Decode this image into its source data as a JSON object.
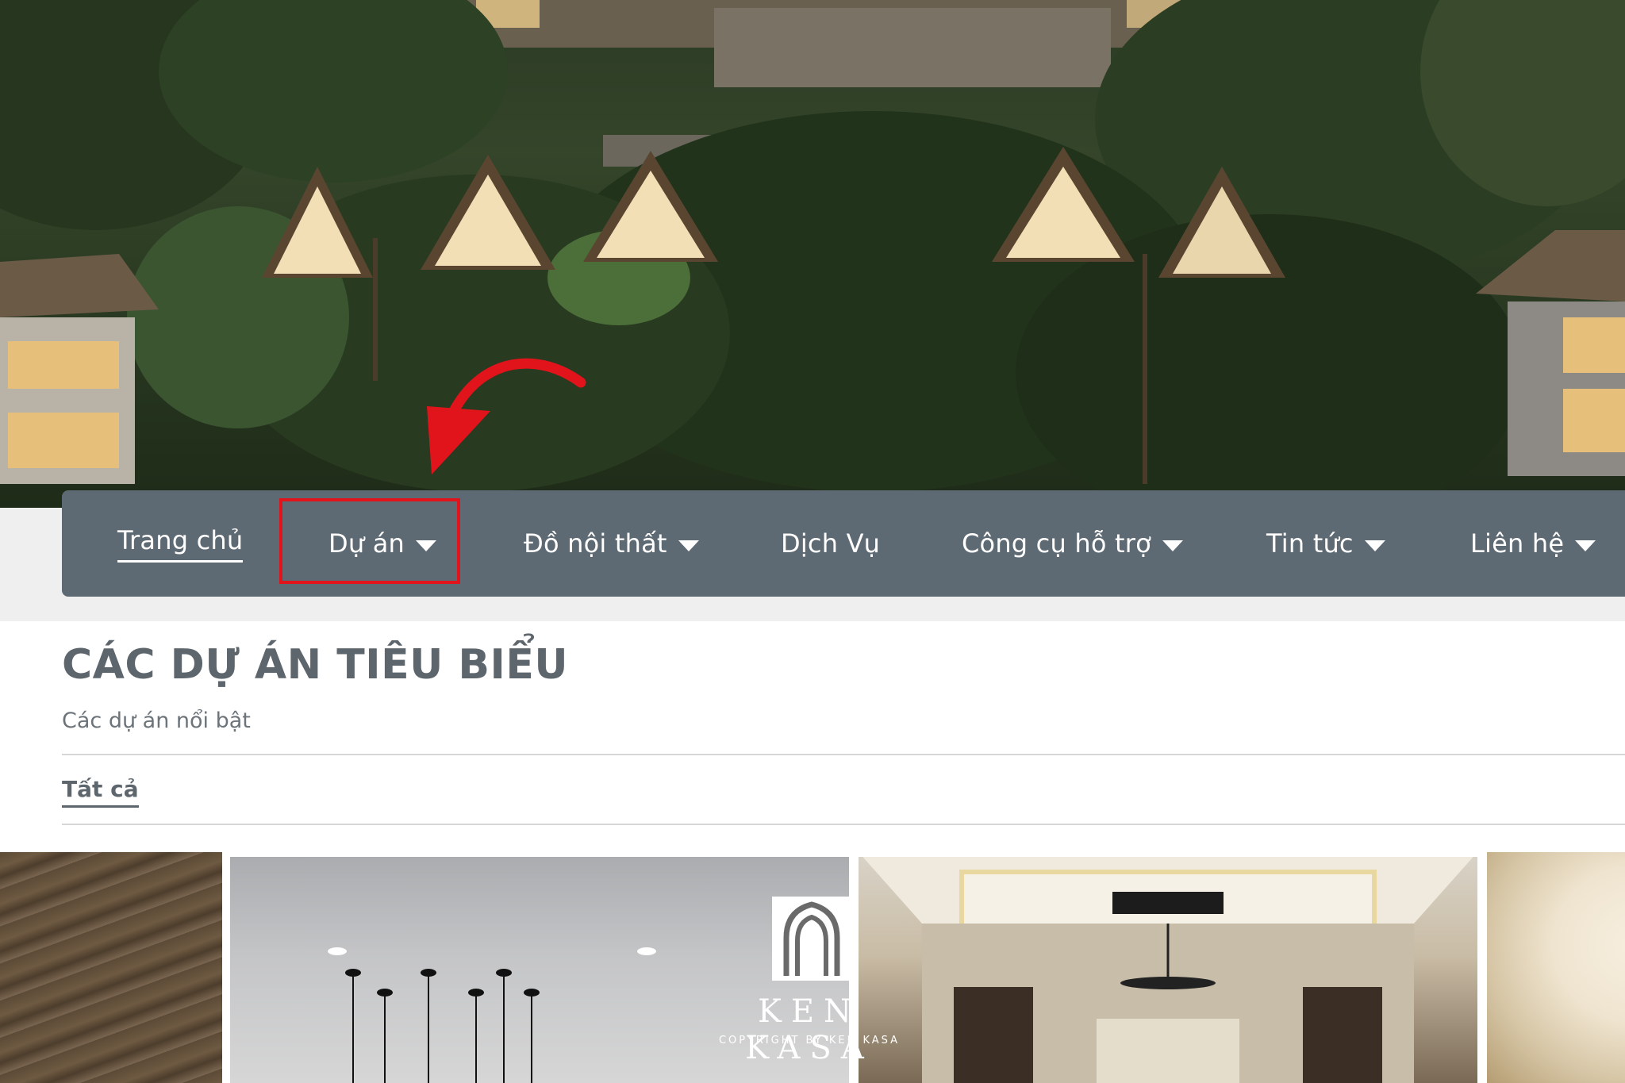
{
  "nav": {
    "items": [
      {
        "label": "Trang chủ",
        "dropdown": false,
        "active": true
      },
      {
        "label": "Dự án",
        "dropdown": true,
        "highlighted": true
      },
      {
        "label": "Đồ nội thất",
        "dropdown": true
      },
      {
        "label": "Dịch Vụ",
        "dropdown": false
      },
      {
        "label": "Công cụ hỗ trợ",
        "dropdown": true
      },
      {
        "label": "Tin tức",
        "dropdown": true
      },
      {
        "label": "Liên hệ",
        "dropdown": true
      }
    ],
    "bar_color": "#5e6a73",
    "highlight_color": "#e1141c"
  },
  "section": {
    "title": "CÁC DỰ ÁN TIÊU BIỂU",
    "subtitle": "Các dự án nổi bật",
    "filter_tab": "Tất cả"
  },
  "watermark": {
    "brand": "KEN KASA",
    "copyright": "COPYRIGHT BY KEN KASA"
  },
  "icons": {
    "caret": "caret-down-icon",
    "arrow": "red-curved-arrow-icon",
    "logo": "arch-logo-icon"
  }
}
